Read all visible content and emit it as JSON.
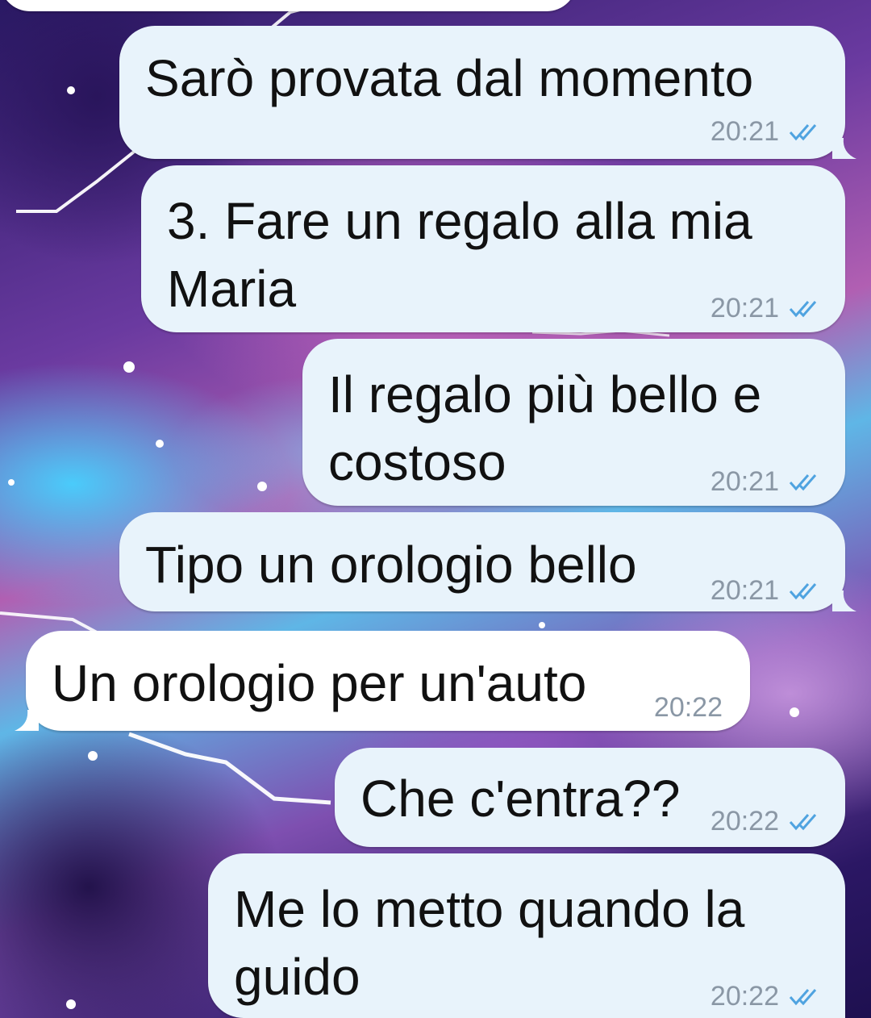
{
  "colors": {
    "outgoing_bubble": "#e8f3fb",
    "incoming_bubble": "#ffffff",
    "timestamp": "#8a97a5",
    "read_ticks": "#4fa3e0"
  },
  "messages": [
    {
      "direction": "outgoing",
      "text": "Sarò provata dal momento",
      "time": "20:21",
      "status_icon": "double-check-icon"
    },
    {
      "direction": "outgoing",
      "lines": [
        "3. Fare un regalo alla mia",
        "Maria"
      ],
      "time": "20:21",
      "status_icon": "double-check-icon"
    },
    {
      "direction": "outgoing",
      "lines": [
        "Il regalo più bello e",
        "costoso"
      ],
      "time": "20:21",
      "status_icon": "double-check-icon"
    },
    {
      "direction": "outgoing",
      "text": "Tipo un orologio bello",
      "time": "20:21",
      "status_icon": "double-check-icon"
    },
    {
      "direction": "incoming",
      "text": "Un orologio per un'auto",
      "time": "20:22"
    },
    {
      "direction": "outgoing",
      "text": "Che c'entra??",
      "time": "20:22",
      "status_icon": "double-check-icon"
    },
    {
      "direction": "outgoing",
      "lines": [
        "Me lo metto quando la",
        "guido"
      ],
      "time": "20:22",
      "status_icon": "double-check-icon"
    }
  ]
}
